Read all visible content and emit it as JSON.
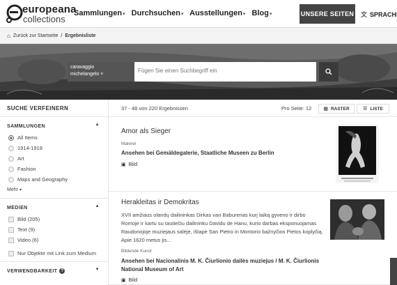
{
  "header": {
    "logo_name": "europeana",
    "logo_sub": "collections",
    "nav": [
      {
        "label": "Sammlungen"
      },
      {
        "label": "Durchsuchen"
      },
      {
        "label": "Ausstellungen"
      },
      {
        "label": "Blog"
      }
    ],
    "unsere_seiten": "UNSERE SEITEN",
    "language": "SPRACHE"
  },
  "breadcrumb": {
    "back": "Zurück zur Startseite",
    "separator": "/",
    "current": "Ergebnisliste"
  },
  "search": {
    "chip_line1": "caravaggio",
    "chip_line2": "michelangelo",
    "chip_remove": "×",
    "placeholder": "Fügen Sie einen Suchbegriff ein"
  },
  "sidebar": {
    "heading": "SUCHE VERFEINERN",
    "sammlungen": {
      "title": "SAMMLUNGEN",
      "options": [
        "All Items",
        "1914-1918",
        "Art",
        "Fashion",
        "Maps and Geography"
      ],
      "selected": "All Items",
      "more": "Mehr"
    },
    "medien": {
      "title": "MEDIEN",
      "options": [
        "Bild (205)",
        "Text (9)",
        "Video (6)"
      ],
      "link_only": "Nur Objekte mit Link zum Medium"
    },
    "verwendbarkeit": {
      "title": "VERWENDBARKEIT"
    }
  },
  "results_bar": {
    "count": "37 - 48 von 220 Ergebnissen",
    "per_page": "Pro Seite: 12",
    "raster": "RASTER",
    "liste": "LISTE"
  },
  "results": [
    {
      "title": "Amor als Sieger",
      "type": "Malerei",
      "institution": "Ansehen bei Gemäldegalerie, Staatliche Museen zu Berlin",
      "media": "Bild"
    },
    {
      "title": "Herakleitas ir Demokritas",
      "description": "XVII amžiaus olandų dailininkas Dirkas van Baburenas kurį laiką gyveno ir dirbo Romoje ir kartu su tautiečiu dailininku Davidu de Hanu, kurio darbas eksponuojamas Raudonojoje muziejaus salėje, ištapė San Pietro in Montorio bažnyčios Pietos koplyčią. Apie 1620 metus jis...",
      "type": "Bildende Kunst",
      "institution": "Ansehen bei Nacionalinis M. K. Čiurlionio dailės muziejus / M. K. Čiurlionis National Museum of Art",
      "media": "Bild"
    }
  ]
}
